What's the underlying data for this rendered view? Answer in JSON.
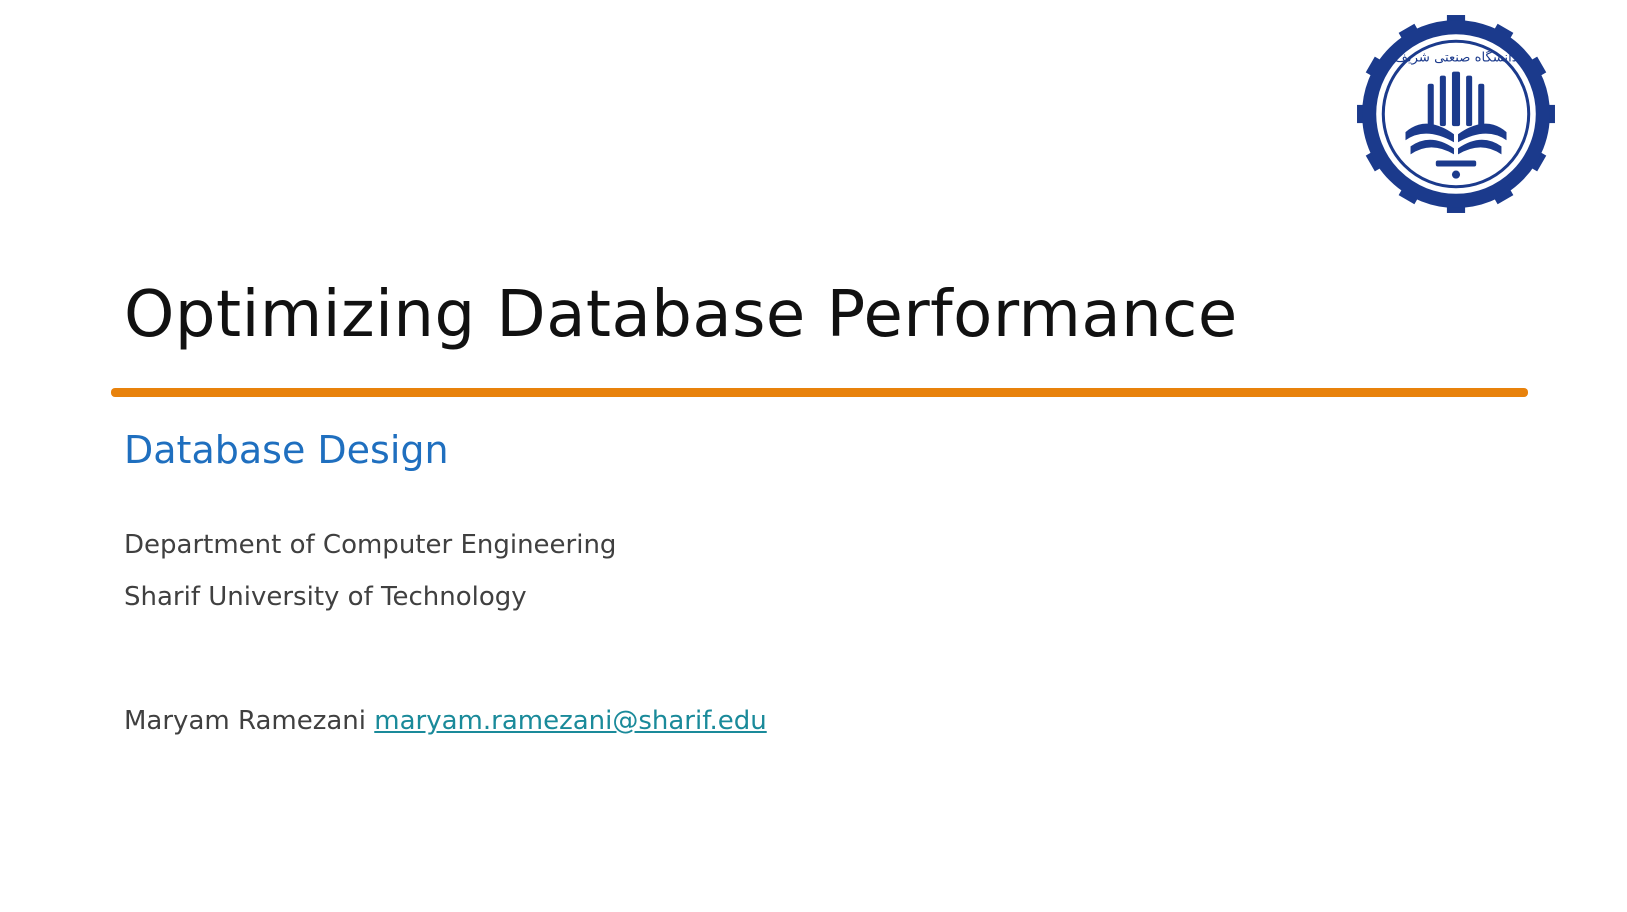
{
  "slide": {
    "title": "Optimizing Database Performance",
    "subtitle": "Database Design",
    "department": "Department of Computer Engineering",
    "university": "Sharif University of Technology",
    "author_name": "Maryam Ramezani",
    "author_email": "maryam.ramezani@sharif.edu"
  },
  "logo": {
    "icon": "sharif-university-seal-icon",
    "arabic_text": "دانشگاه صنعتی شریف"
  },
  "colors": {
    "title": "#111111",
    "accent_rule": "#E8820C",
    "subtitle": "#1F6FBF",
    "body_text": "#404040",
    "link": "#1A8A9A",
    "seal": "#1B3A8C"
  }
}
